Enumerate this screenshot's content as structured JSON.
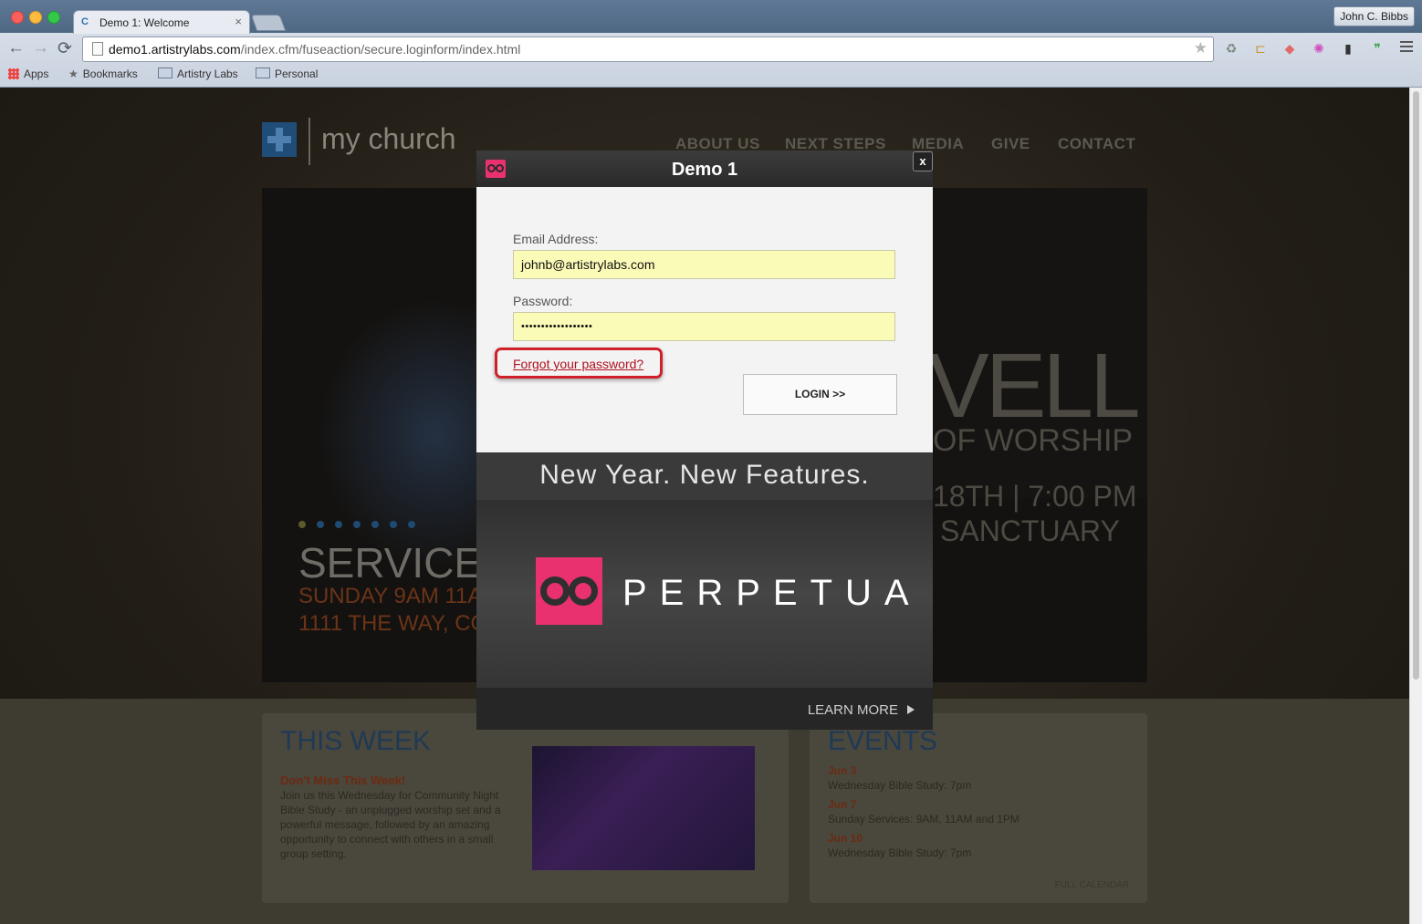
{
  "browser": {
    "tab_favicon": "C",
    "tab_title": "Demo 1: Welcome",
    "tab_close": "×",
    "profile_name": "John C. Bibbs",
    "url_host": "demo1.artistrylabs.com",
    "url_path": "/index.cfm/fuseaction/secure.loginform/index.html",
    "icons": {
      "back": "←",
      "forward": "→",
      "reload": "⟳",
      "star": "★",
      "ext1": "♻",
      "ext2": "⊏",
      "ext3": "◆",
      "ext4": "✺",
      "ext5": "▮",
      "ext6": "❞"
    },
    "bookmarks": [
      {
        "label": "Apps"
      },
      {
        "label": "Bookmarks"
      },
      {
        "label": "Artistry Labs"
      },
      {
        "label": "Personal"
      }
    ]
  },
  "site": {
    "logo_text": "my church",
    "nav": [
      "ABOUT US",
      "NEXT STEPS",
      "MEDIA",
      "GIVE",
      "CONTACT"
    ],
    "hero": {
      "big": "VELL",
      "line2": "OF WORSHIP",
      "line3": "18TH | 7:00 PM",
      "line4": "SANCTUARY"
    },
    "services": {
      "title": "SERVICES",
      "line2": "SUNDAY 9AM 11A",
      "line3": "1111 THE WAY, CO"
    },
    "this_week": {
      "title": "THIS WEEK",
      "subtitle": "Don't Miss This Week!",
      "body": "Join us this Wednesday for Community Night Bible Study - an unplugged worship set and a powerful message, followed by an amazing opportunity to connect with others in a small group setting."
    },
    "events": {
      "title": "EVENTS",
      "items": [
        {
          "date": "Jun 3",
          "text": "Wednesday Bible Study: 7pm"
        },
        {
          "date": "Jun 7",
          "text": "Sunday Services: 9AM, 11AM and 1PM"
        },
        {
          "date": "Jun 10",
          "text": "Wednesday Bible Study: 7pm"
        }
      ],
      "full_calendar": "FULL CALENDAR"
    }
  },
  "modal": {
    "title": "Demo 1",
    "close": "x",
    "email_label": "Email Address:",
    "email_value": "johnb@artistrylabs.com",
    "password_label": "Password:",
    "password_value": "••••••••••••••••••",
    "forgot_link": "Forgot your password?",
    "login_button": "LOGIN >>",
    "promo": {
      "headline": "New Year. New Features.",
      "brand": "PERPETUA",
      "learn_more": "LEARN MORE"
    },
    "colors": {
      "brand_pink": "#e8316e",
      "highlight_red": "#d0202a"
    }
  }
}
